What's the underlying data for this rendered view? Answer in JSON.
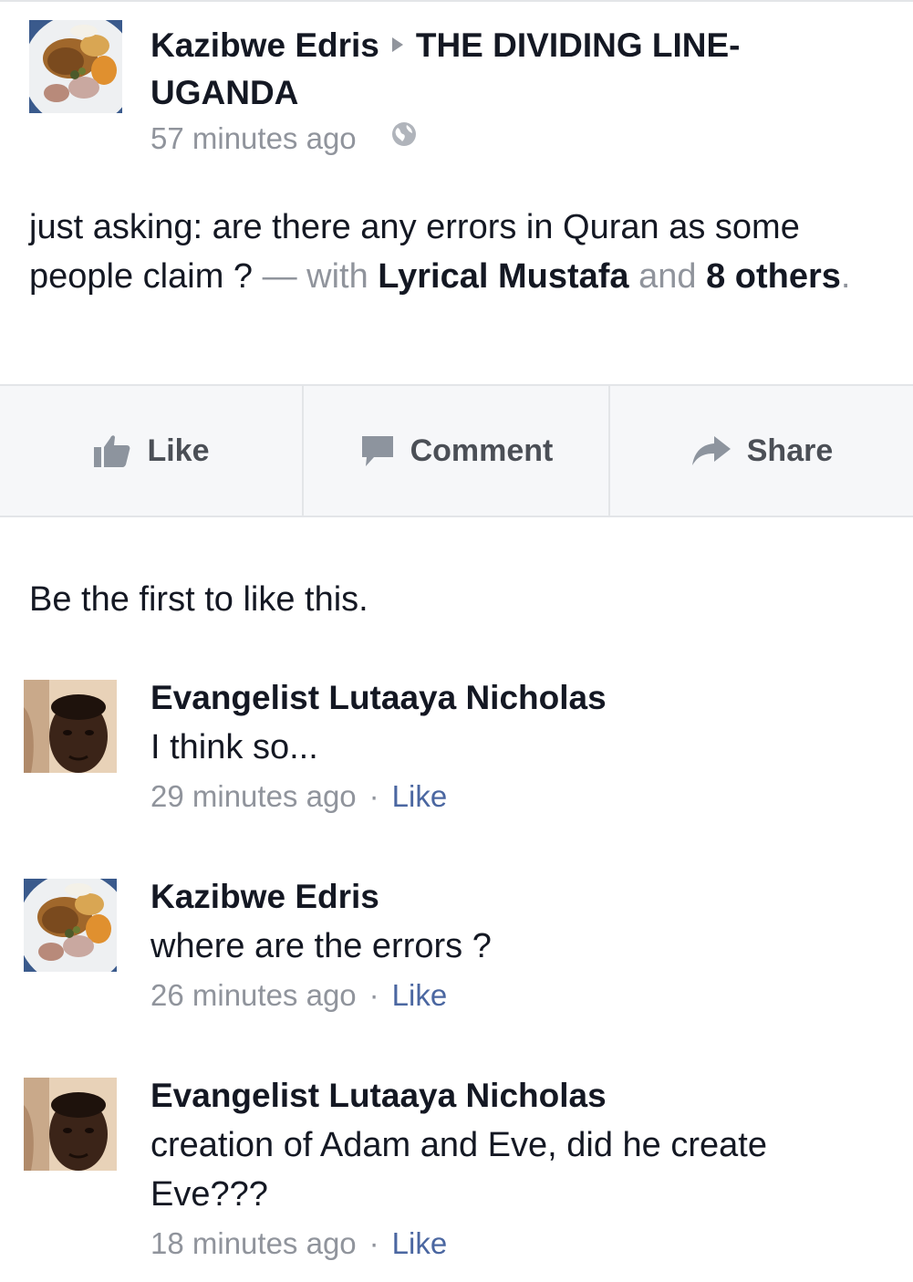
{
  "post": {
    "author": "Kazibwe Edris",
    "group": "THE DIVIDING LINE-UGANDA",
    "timestamp": "57 minutes ago",
    "privacy_icon": "globe-icon",
    "text": "just asking: are there any errors in Quran as some people claim ?",
    "with_dash": " — with ",
    "tagged_person": "Lyrical Mustafa",
    "and_text": " and ",
    "others_text": "8 others",
    "period": "."
  },
  "actions": {
    "like_label": "Like",
    "comment_label": "Comment",
    "share_label": "Share"
  },
  "likes_summary": "Be the first to like this.",
  "comments": [
    {
      "author": "Evangelist Lutaaya Nicholas",
      "text": "I think so...",
      "timestamp": "29 minutes ago",
      "like_label": "Like"
    },
    {
      "author": "Kazibwe Edris",
      "text": "where are the errors ?",
      "timestamp": "26 minutes ago",
      "like_label": "Like"
    },
    {
      "author": "Evangelist Lutaaya Nicholas",
      "text": "creation of Adam and Eve, did he create Eve???",
      "timestamp": "18 minutes ago",
      "like_label": "Like"
    }
  ],
  "colors": {
    "text": "#141823",
    "meta": "#90949c",
    "link": "#4b67a1",
    "action_bar_bg": "#f6f7f9",
    "divider": "#e3e5e8"
  }
}
